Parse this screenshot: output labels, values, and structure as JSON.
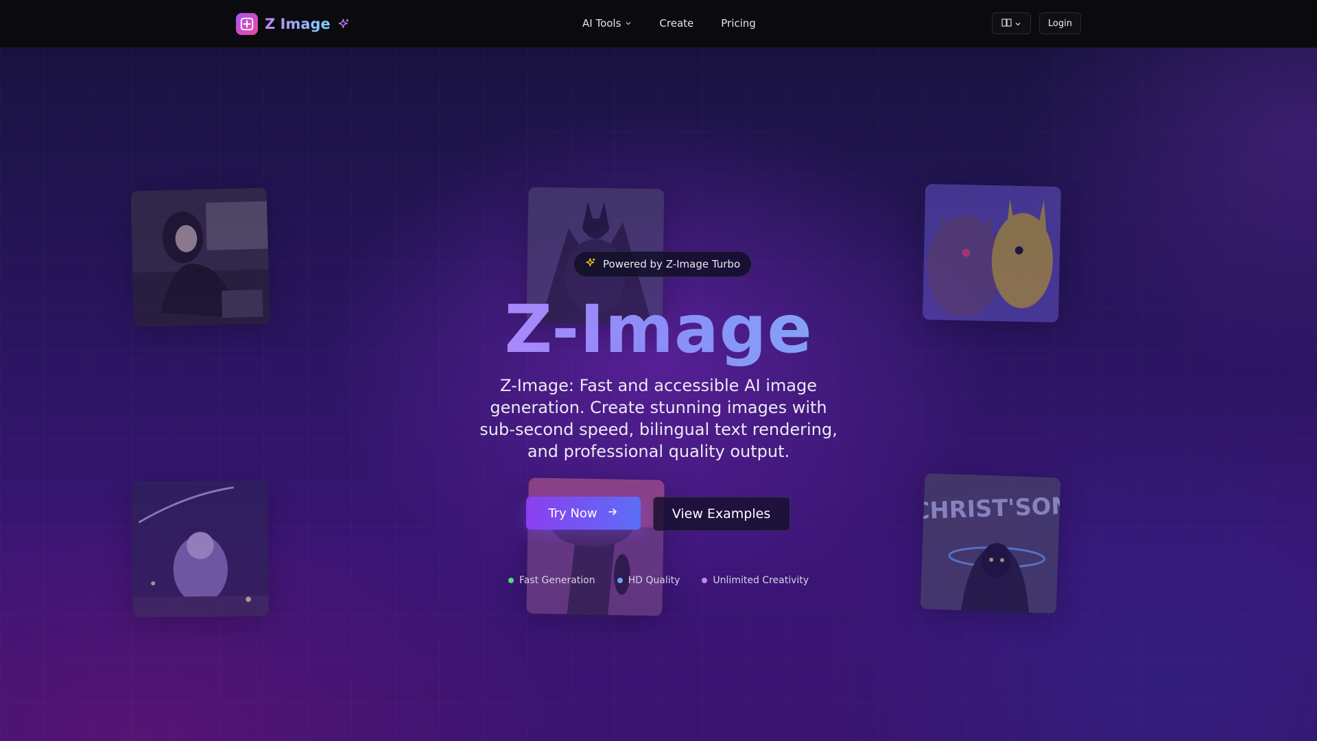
{
  "brand": {
    "name": "Z Image",
    "accent_gradient": [
      "#a855f7",
      "#ec4899"
    ]
  },
  "nav": {
    "items": [
      {
        "label": "AI Tools",
        "has_dropdown": true
      },
      {
        "label": "Create"
      },
      {
        "label": "Pricing"
      }
    ]
  },
  "header": {
    "language_icon": "language-icon",
    "login_label": "Login"
  },
  "hero": {
    "badge_label": "Powered by Z-Image Turbo",
    "title": "Z-Image",
    "description": "Z-Image: Fast and accessible AI image generation. Create stunning images with sub-second speed, bilingual text rendering, and professional quality output.",
    "primary_cta": "Try Now",
    "secondary_cta": "View Examples",
    "features": [
      {
        "label": "Fast Generation",
        "color": "#4ade80"
      },
      {
        "label": "HD Quality",
        "color": "#60a5fa"
      },
      {
        "label": "Unlimited Creativity",
        "color": "#c084fc"
      }
    ]
  },
  "gallery": {
    "images": [
      {
        "subject": "woman-portrait"
      },
      {
        "subject": "dark-knight"
      },
      {
        "subject": "pikachu-and-creature"
      },
      {
        "subject": "fairy-girl-night"
      },
      {
        "subject": "figure-under-tree"
      },
      {
        "subject": "christson-graffiti",
        "text": "CHRIST'SON"
      }
    ]
  }
}
